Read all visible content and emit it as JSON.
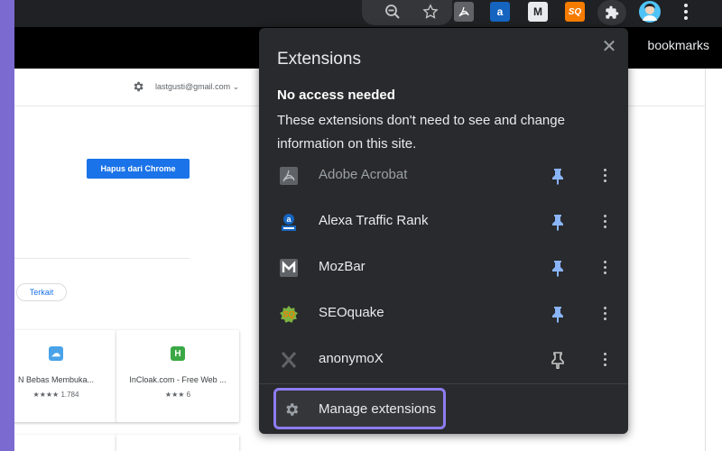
{
  "toolbar": {
    "icons": [
      "zoom-icon",
      "star-icon",
      "adobe-acrobat-icon",
      "alexa-icon",
      "mozbar-icon",
      "seoquake-icon",
      "extensions-puzzle-icon",
      "profile-avatar",
      "more-vert-icon"
    ],
    "bookmarks_label": "bookmarks"
  },
  "page": {
    "account_email": "lastgusti@gmail.com",
    "remove_button": "Hapus dari Chrome",
    "related_chip": "Terkait",
    "cards": [
      {
        "title": "N Bebas Membuka...",
        "rating_count": "1.784",
        "stars": "★★★★",
        "icon_glyph": "☁",
        "icon_color": "#4aa3e8"
      },
      {
        "title": "InCloak.com - Free Web ...",
        "rating_count": "6",
        "stars": "★★★",
        "icon_glyph": "H",
        "icon_color": "#3aa845"
      }
    ]
  },
  "popup": {
    "title": "Extensions",
    "close_glyph": "✕",
    "section_heading": "No access needed",
    "section_description": "These extensions don't need to see and change information on this site.",
    "extensions": [
      {
        "name": "Adobe Acrobat",
        "icon": "adobe-acrobat-icon",
        "pinned": true,
        "dim": true
      },
      {
        "name": "Alexa Traffic Rank",
        "icon": "alexa-icon",
        "pinned": true,
        "dim": false
      },
      {
        "name": "MozBar",
        "icon": "mozbar-icon",
        "pinned": true,
        "dim": false
      },
      {
        "name": "SEOquake",
        "icon": "seoquake-icon",
        "pinned": true,
        "dim": false
      },
      {
        "name": "anonymoX",
        "icon": "anonymox-icon",
        "pinned": false,
        "dim": false
      }
    ],
    "manage_label": "Manage extensions"
  },
  "colors": {
    "pin_active": "#8ab4f8",
    "pin_inactive": "#c4c7c5",
    "highlight": "#8e7cf0",
    "popup_bg": "#292a2d"
  }
}
